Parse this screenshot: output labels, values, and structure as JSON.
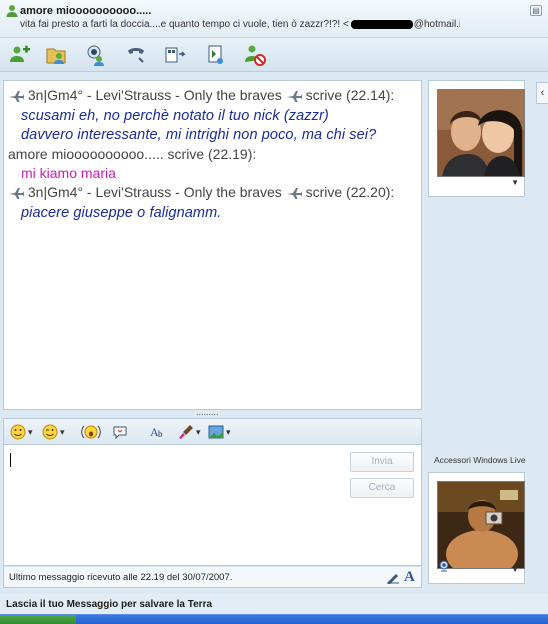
{
  "window": {
    "contact_name": "amore mioooooooooo.....",
    "status_message_start": "vita fai presto a farti la doccia....e quanto tempo ci vuole, tien ò zazzr?!?! <",
    "status_message_end": "@hotmail.it>"
  },
  "toolbar": {
    "items": [
      {
        "icon": "invite-contact-icon"
      },
      {
        "icon": "send-files-icon"
      },
      {
        "icon": "webcam-icon"
      },
      {
        "icon": "call-icon"
      },
      {
        "icon": "activities-icon"
      },
      {
        "icon": "games-icon"
      },
      {
        "icon": "block-contact-icon"
      }
    ]
  },
  "conversation": {
    "messages": [
      {
        "sender": "3n|Gm4° - Levi'Strauss - Only the braves",
        "has_planes": true,
        "verb": "scrive",
        "time": "(22.14):",
        "lines": [
          "scusami eh, no perchè notato il tuo nick (zazzr)",
          "davvero interessante, mi intrighi non poco, ma chi sei?"
        ],
        "style": "blue"
      },
      {
        "sender": "amore mioooooooooo.....",
        "has_planes": false,
        "verb": "scrive",
        "time": "(22.19):",
        "lines": [
          "mi kiamo maria"
        ],
        "style": "pink"
      },
      {
        "sender": "3n|Gm4° - Levi'Strauss - Only the braves",
        "has_planes": true,
        "verb": "scrive",
        "time": "(22.20):",
        "lines": [
          "piacere giuseppe o falignamm."
        ],
        "style": "blue"
      }
    ],
    "divider": "........."
  },
  "input": {
    "send_label": "Invia",
    "search_label": "Cerca"
  },
  "status_bar": {
    "text": "Ultimo messaggio ricevuto alle 22.19 del 30/07/2007.",
    "text_mode_label": "A"
  },
  "right_panel": {
    "accessories_label": "Accessori Windows Live"
  },
  "footer": {
    "text": "Lascia il tuo Messaggio per salvare la Terra"
  },
  "colors": {
    "accent": "#2a57a8",
    "message_blue": "#1a2a9c",
    "message_pink": "#d319b5"
  }
}
